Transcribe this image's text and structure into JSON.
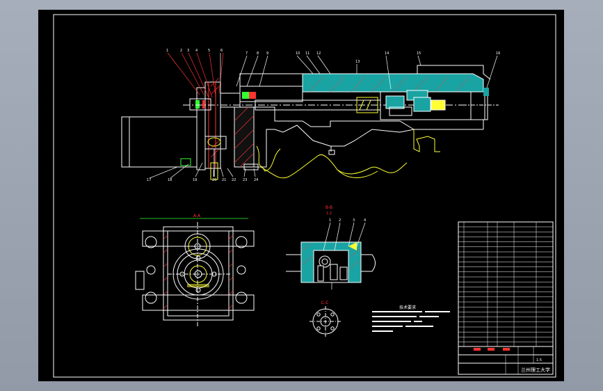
{
  "section_labels": {
    "view_a_title": "A-A",
    "view_b_title": "B-B",
    "view_b_scale": "1:2",
    "view_c_title": "C-C"
  },
  "notes": {
    "heading": "技术要求"
  },
  "title_block": {
    "university": "兰州理工大学",
    "scale": "1:5"
  },
  "colors": {
    "outline": "#ffffff",
    "section_fill": "#1aa3a3",
    "hatch": "#ff3333",
    "yellow": "#ffff33",
    "green": "#33ff33",
    "cyan": "#33ffff"
  }
}
